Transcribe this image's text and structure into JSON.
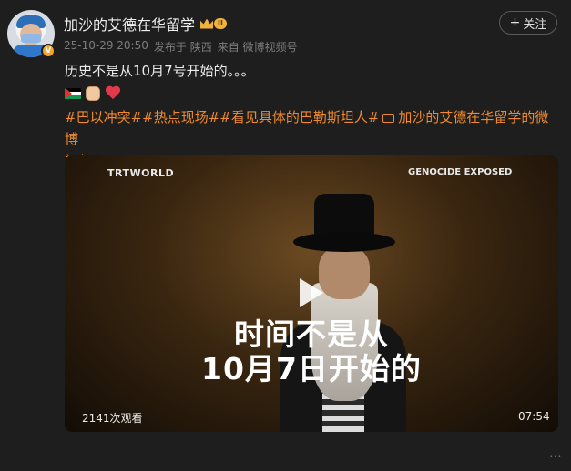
{
  "post": {
    "username": "加沙的艾德在华留学",
    "member_level": "II",
    "verified_badge": "V",
    "timestamp": "25-10-29 20:50",
    "published_from": "发布于 陕西",
    "source": "来自 微博视频号",
    "follow_label": "关注",
    "text": "历史不是从10月7号开始的。。。",
    "emojis": [
      "palestine-flag-icon",
      "raised-fist-icon",
      "heart-icon"
    ],
    "tags_line1": "#巴以冲突##热点现场##看见具体的巴勒斯坦人#",
    "tags_video_link": "加沙的艾德在华留学的微博",
    "tags_line2": "视频"
  },
  "video": {
    "watermark_left": "TRTWORLD",
    "watermark_right": "GENOCIDE EXPOSED",
    "subtitle_line1": "时间不是从",
    "subtitle_line2": "10月7日开始的",
    "views": "2141次观看",
    "duration": "07:54"
  },
  "footer": {
    "more_icon": "⋯"
  },
  "colors": {
    "background": "#1e1e1e",
    "tag_orange": "#f08a2c",
    "badge_gold": "#f0b23a"
  }
}
